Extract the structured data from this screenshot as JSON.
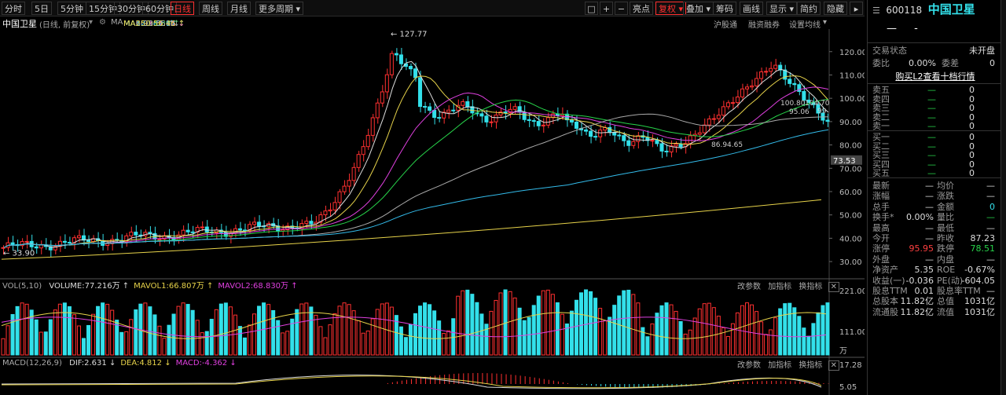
{
  "toolbar": {
    "periods": [
      "分时",
      "5日",
      "5分钟",
      "15分钟",
      "30分钟",
      "60分钟",
      "日线",
      "周线",
      "月线",
      "更多周期"
    ],
    "active": "日线",
    "right_buttons": [
      "亮点",
      "复权",
      "叠加",
      "筹码",
      "画线",
      "显示",
      "简约",
      "隐藏"
    ],
    "active_right": "复权",
    "icons": [
      "□",
      "+",
      "−"
    ]
  },
  "header": {
    "stock_name": "中国卫星",
    "mode": "(日线, 前复权)",
    "ma_label": "MA",
    "ma": [
      {
        "text": "MA5:98.55",
        "arrow": "↑",
        "color": "#dddddd"
      },
      {
        "text": "MA10:104.91",
        "arrow": "↓",
        "color": "#e7d34a"
      },
      {
        "text": "MA20:101.14",
        "arrow": "↓",
        "color": "#e040e0"
      },
      {
        "text": "MA30:94.30",
        "arrow": "↑",
        "color": "#27d34a"
      },
      {
        "text": "MA60:90.51",
        "arrow": "↓",
        "color": "#aaaaaa"
      },
      {
        "text": "MA120:82.67",
        "arrow": "↑",
        "color": "#33bbea"
      },
      {
        "text": "MA250:56.46",
        "arrow": "↑",
        "color": "#e7d34a"
      }
    ],
    "links": [
      "沪股通",
      "融资融券",
      "设置均线"
    ]
  },
  "chart_data": {
    "type": "candlestick",
    "price_axis": [
      120,
      110,
      100,
      90,
      80,
      70,
      60,
      50,
      40,
      30
    ],
    "price_ylim": [
      27,
      128
    ],
    "current_price": "73.53",
    "high_marker": "127.77",
    "low_marker": "33.90",
    "ma_inline_labels": [
      "100.80",
      "104.70",
      "95.06",
      "99",
      "86.94.65"
    ],
    "vol_label": "VOL(5,10)",
    "vol_values": [
      {
        "text": "VOLUME:77.216万",
        "arrow": "↑",
        "color": "#dddddd"
      },
      {
        "text": "MAVOL1:66.807万",
        "arrow": "↑",
        "color": "#e7d34a"
      },
      {
        "text": "MAVOL2:68.830万",
        "arrow": "↑",
        "color": "#e040e0"
      }
    ],
    "vol_axis": [
      "221.00",
      "111.00",
      "万"
    ],
    "macd_label": "MACD(12,26,9)",
    "macd_values": [
      {
        "text": "DIF:2.631",
        "arrow": "↓",
        "color": "#dddddd"
      },
      {
        "text": "DEA:4.812",
        "arrow": "↓",
        "color": "#e7d34a"
      },
      {
        "text": "MACD:-4.362",
        "arrow": "↓",
        "color": "#e040e0"
      }
    ],
    "macd_axis": [
      "17.28",
      "5.05",
      "-7.18"
    ],
    "sub_links": [
      "改参数",
      "加指标",
      "换指标"
    ]
  },
  "panel": {
    "code": "600118",
    "name": "中国卫星",
    "dash1": "—",
    "dash2": "-",
    "trade_status_label": "交易状态",
    "trade_status": "未开盘",
    "weibi_label": "委比",
    "weibi": "0.00%",
    "weicha_label": "委差",
    "weicha": "0",
    "l2_link": "购买L2查看十档行情",
    "asks": [
      {
        "l": "卖五",
        "p": "—",
        "v": "0"
      },
      {
        "l": "卖四",
        "p": "—",
        "v": "0"
      },
      {
        "l": "卖三",
        "p": "—",
        "v": "0"
      },
      {
        "l": "卖二",
        "p": "—",
        "v": "0"
      },
      {
        "l": "卖一",
        "p": "—",
        "v": "0"
      }
    ],
    "bids": [
      {
        "l": "买一",
        "p": "—",
        "v": "0"
      },
      {
        "l": "买二",
        "p": "—",
        "v": "0"
      },
      {
        "l": "买三",
        "p": "—",
        "v": "0"
      },
      {
        "l": "买四",
        "p": "—",
        "v": "0"
      },
      {
        "l": "买五",
        "p": "—",
        "v": "0"
      }
    ],
    "stats": [
      {
        "a": "最新",
        "av": "—",
        "b": "均价",
        "bv": "—"
      },
      {
        "a": "涨幅",
        "av": "—",
        "b": "涨跌",
        "bv": "—"
      },
      {
        "a": "总手",
        "av": "—",
        "b": "金额",
        "bv": "0"
      },
      {
        "a": "换手*",
        "av": "0.00%",
        "b": "量比",
        "bv": "—"
      },
      {
        "a": "最高",
        "av": "—",
        "b": "最低",
        "bv": "—"
      },
      {
        "a": "今开",
        "av": "—",
        "b": "昨收",
        "bv": "87.23"
      },
      {
        "a": "涨停",
        "av": "95.95",
        "b": "跌停",
        "bv": "78.51"
      },
      {
        "a": "外盘",
        "av": "—",
        "b": "内盘",
        "bv": "—"
      },
      {
        "a": "净资产",
        "av": "5.35",
        "b": "ROE",
        "bv": "-0.67%"
      },
      {
        "a": "收益(一)",
        "av": "-0.036",
        "b": "PE(动)",
        "bv": "-604.05"
      },
      {
        "a": "股息TTM",
        "av": "0.01",
        "b": "股息率TTM",
        "bv": "—"
      },
      {
        "a": "总股本",
        "av": "11.82亿",
        "b": "总值",
        "bv": "1031亿"
      },
      {
        "a": "流通股",
        "av": "11.82亿",
        "b": "流值",
        "bv": "1031亿"
      }
    ]
  }
}
